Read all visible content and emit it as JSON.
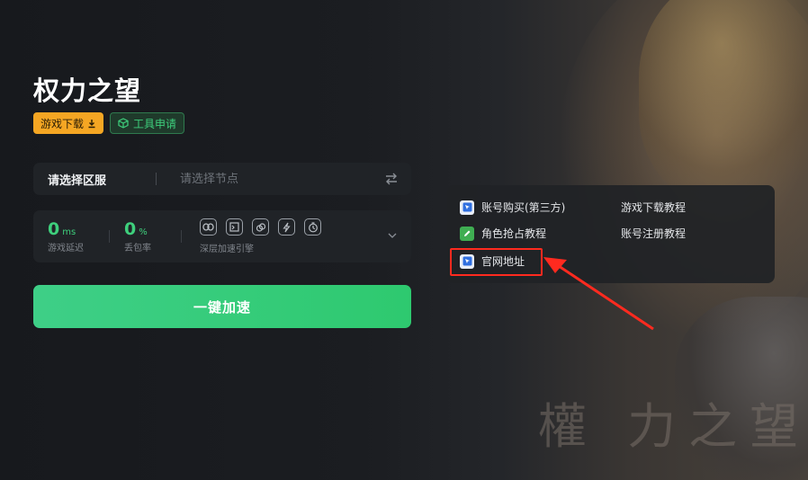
{
  "game": {
    "title": "权力之望",
    "watermark": "權 力之望"
  },
  "tags": {
    "download_label": "游戏下载",
    "tool_label": "工具申请"
  },
  "server": {
    "region_label": "请选择区服",
    "node_placeholder": "请选择节点"
  },
  "stats": {
    "latency_value": "0",
    "latency_unit": "ms",
    "latency_label": "游戏延迟",
    "loss_value": "0",
    "loss_unit": "%",
    "loss_label": "丢包率",
    "engine_label": "深层加速引擎",
    "engine_icons": [
      "link-icon",
      "window-icon",
      "chain-icon",
      "lightning-icon",
      "timer-icon"
    ]
  },
  "accelerate_label": "一键加速",
  "links": {
    "account_buy": "账号购买(第三方)",
    "download_tutorial": "游戏下载教程",
    "role_tutorial": "角色抢占教程",
    "register_tutorial": "账号注册教程",
    "official_site": "官网地址"
  },
  "colors": {
    "accent_green": "#2ec96f",
    "tag_orange": "#f5a623",
    "highlight_red": "#ff2a1f"
  }
}
